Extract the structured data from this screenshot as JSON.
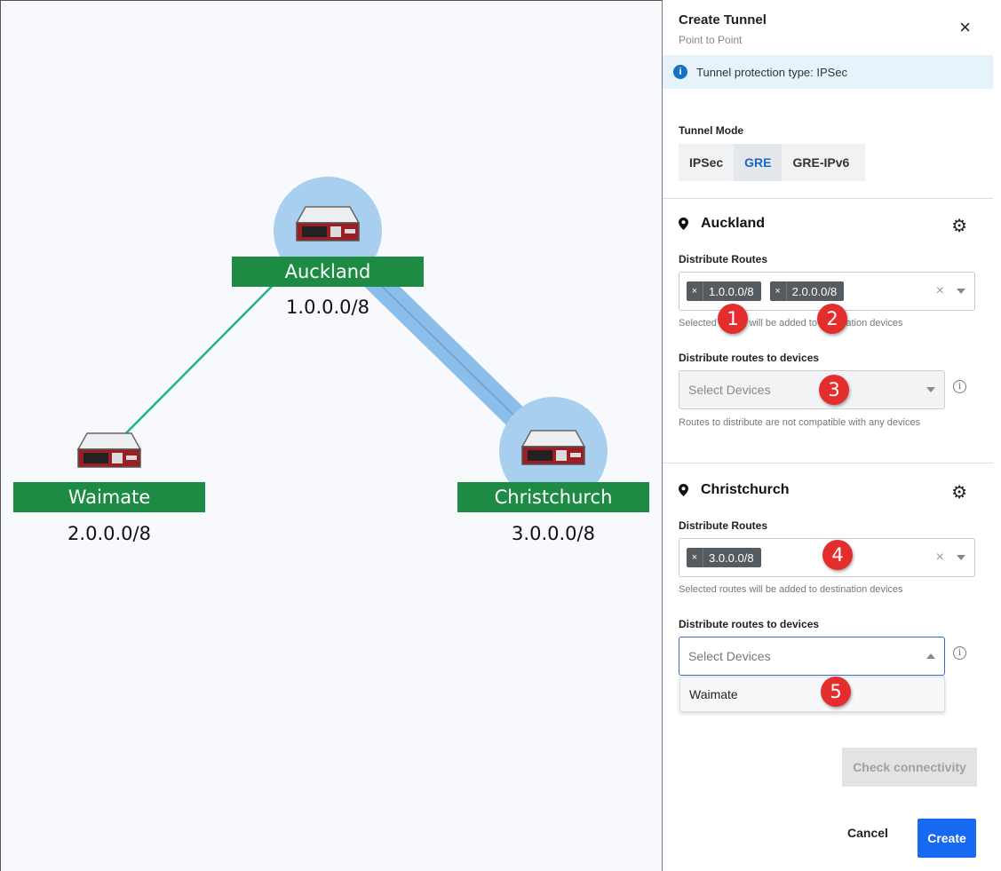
{
  "topology": {
    "nodes": [
      {
        "name": "Auckland",
        "subnet": "1.0.0.0/8"
      },
      {
        "name": "Waimate",
        "subnet": "2.0.0.0/8"
      },
      {
        "name": "Christchurch",
        "subnet": "3.0.0.0/8"
      }
    ],
    "colors": {
      "label_bg": "#1e8b45",
      "link_green": "#1fb493",
      "halo": "#a9cfef",
      "tunnel": "#8bbfea"
    }
  },
  "panel": {
    "title": "Create Tunnel",
    "subtitle": "Point to Point",
    "close_icon": "×",
    "info_banner": "Tunnel protection type: IPSec",
    "tunnel_mode_label": "Tunnel Mode",
    "modes": [
      "IPSec",
      "GRE",
      "GRE-IPv6"
    ],
    "active_mode": "GRE",
    "sites": [
      {
        "name": "Auckland",
        "distribute_routes_label": "Distribute Routes",
        "routes": [
          "1.0.0.0/8",
          "2.0.0.0/8"
        ],
        "routes_help": "Selected routes will be added to destination devices",
        "devices_label": "Distribute routes to devices",
        "devices_placeholder": "Select Devices",
        "devices_help": "Routes to distribute are not compatible with any devices"
      },
      {
        "name": "Christchurch",
        "distribute_routes_label": "Distribute Routes",
        "routes": [
          "3.0.0.0/8"
        ],
        "routes_help": "Selected routes will be added to destination devices",
        "devices_label": "Distribute routes to devices",
        "devices_placeholder": "Select Devices",
        "device_options": [
          "Waimate"
        ]
      }
    ],
    "check_connectivity": "Check connectivity",
    "cancel": "Cancel",
    "create": "Create",
    "accent_color": "#1669f0"
  },
  "callouts": [
    "1",
    "2",
    "3",
    "4",
    "5"
  ]
}
